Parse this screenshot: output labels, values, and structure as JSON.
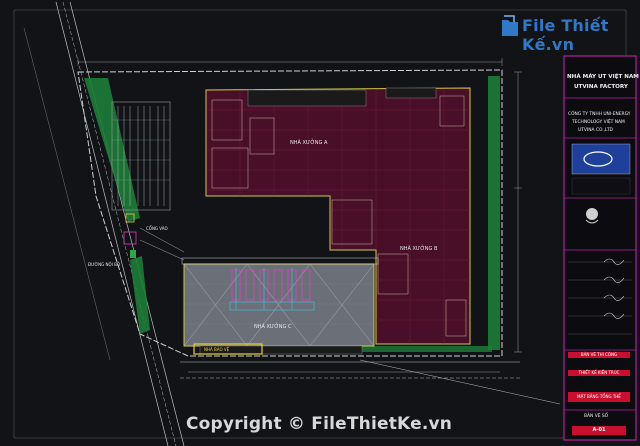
{
  "logo": {
    "brand_name": "File Thiết Kế",
    "brand_suffix": ".vn",
    "icon": "file-folder-icon"
  },
  "watermark": {
    "text": "Copyright © FileThietKe.vn"
  },
  "title_block": {
    "project_title_line1": "NHÀ MÁY UT VIỆT NAM",
    "project_title_line2": "UTVINA FACTORY",
    "company_line1": "CÔNG TY TNHH UNI-ENERGY",
    "company_line2": "TECHNOLOGY VIỆT NAM",
    "company_line3": "UTVINA CO.,LTD",
    "red_label_1": "BẢN VẼ THI CÔNG",
    "red_label_2": "THIẾT KẾ KIẾN TRÚC",
    "red_label_3": "MẶT BẰNG TỔNG THỂ",
    "red_label_4": "BẢN VẼ SỐ",
    "sheet_no": "A-01"
  },
  "plan_labels": {
    "building_a": "NHÀ XƯỞNG A",
    "building_b": "NHÀ XƯỞNG B",
    "building_c": "NHÀ XƯỞNG C",
    "road_label": "ĐƯỜNG NỘI BỘ",
    "gate_label": "CỔNG VÀO",
    "guard_label": "NHÀ BẢO VỆ"
  },
  "colors": {
    "background": "#111317",
    "boundary_green": "#2fa84a",
    "hatch_maroon": "#5a1230",
    "title_border": "#b020a0",
    "accent_red": "#c8102e",
    "brand_blue": "#2f79c8"
  }
}
